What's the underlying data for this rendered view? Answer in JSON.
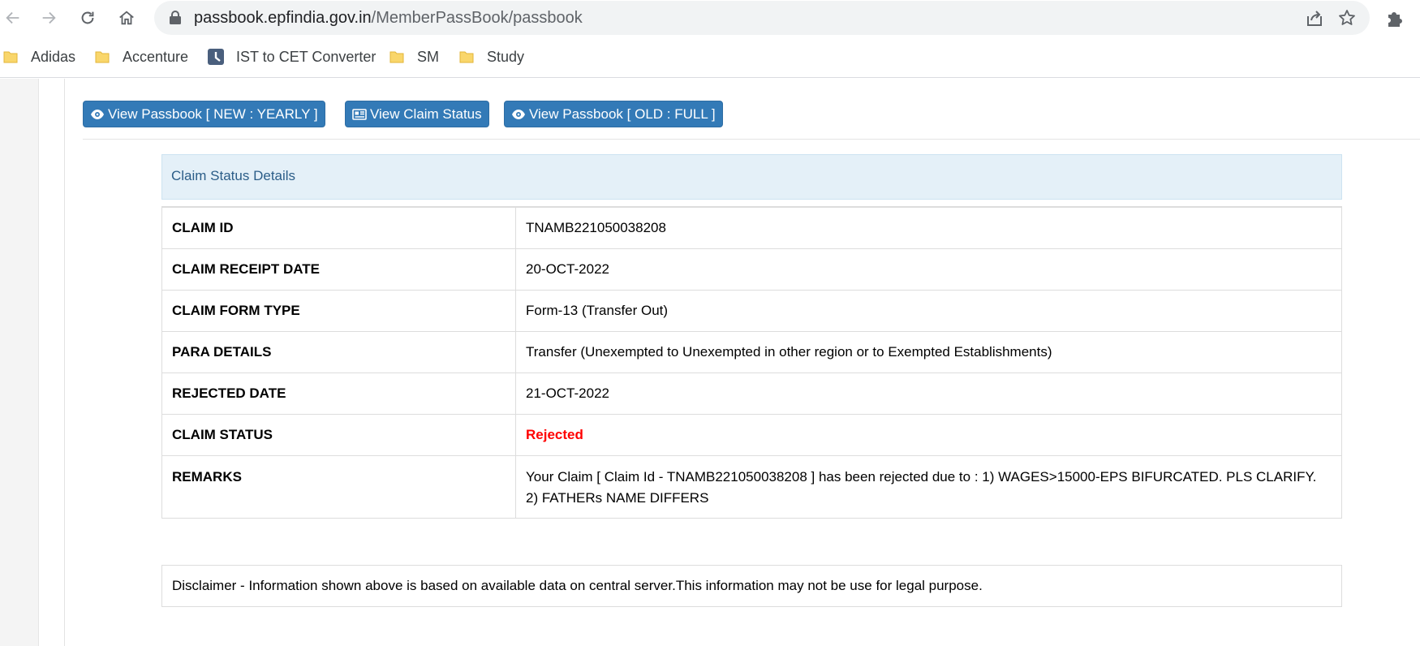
{
  "browser": {
    "url_host": "passbook.epfindia.gov.in",
    "url_path": "/MemberPassBook/passbook",
    "icons": [
      "back-icon",
      "forward-icon",
      "reload-icon",
      "home-icon",
      "lock-icon",
      "share-icon",
      "star-icon",
      "extensions-icon"
    ]
  },
  "bookmarks": [
    {
      "label": "Adidas",
      "icon": "folder-icon"
    },
    {
      "label": "Accenture",
      "icon": "folder-icon"
    },
    {
      "label": "IST to CET Converter",
      "icon": "clock-icon"
    },
    {
      "label": "SM",
      "icon": "folder-icon"
    },
    {
      "label": "Study",
      "icon": "folder-icon"
    }
  ],
  "actions": {
    "passbook_new": "View Passbook [ NEW : YEARLY ]",
    "claim_status": "View Claim Status",
    "passbook_old": "View Passbook [ OLD : FULL ]"
  },
  "panel": {
    "title": "Claim Status Details"
  },
  "details": [
    {
      "label": "CLAIM ID",
      "value": "TNAMB221050038208"
    },
    {
      "label": "CLAIM RECEIPT DATE",
      "value": "20-OCT-2022"
    },
    {
      "label": "CLAIM FORM TYPE",
      "value": "Form-13 (Transfer Out)"
    },
    {
      "label": "PARA DETAILS",
      "value": "Transfer (Unexempted to Unexempted in other region or to Exempted Establishments)"
    },
    {
      "label": "REJECTED DATE",
      "value": "21-OCT-2022"
    },
    {
      "label": "CLAIM STATUS",
      "value": "Rejected"
    },
    {
      "label": "REMARKS",
      "value": "Your Claim [ Claim Id - TNAMB221050038208 ] has been rejected due to : 1) WAGES>15000-EPS BIFURCATED. PLS CLARIFY. 2) FATHERs NAME DIFFERS"
    }
  ],
  "colors": {
    "primary_button": "#337ab7",
    "panel_heading_bg": "#e4f0f8",
    "rejected": "#ff0000"
  },
  "disclaimer": "Disclaimer - Information shown above is based on available data on central server.This information may not be use for legal purpose."
}
